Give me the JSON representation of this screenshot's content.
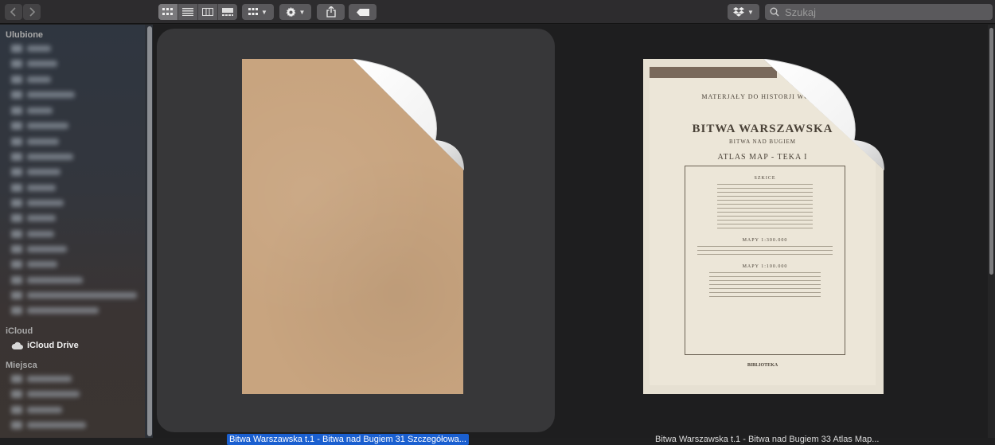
{
  "toolbar": {
    "back_icon": "chevron-left-icon",
    "forward_icon": "chevron-right-icon",
    "view_modes": [
      "icon-view",
      "list-view",
      "column-view",
      "gallery-view"
    ],
    "active_view": "icon-view",
    "search": {
      "placeholder": "Szukaj",
      "value": ""
    }
  },
  "sidebar": {
    "favorites_heading": "Ulubione",
    "icloud_heading": "iCloud",
    "icloud_drive_label": "iCloud Drive",
    "places_heading": "Miejsca"
  },
  "files": [
    {
      "name": "Bitwa Warszawska t.1 - Bitwa nad Bugiem 31 Szczegółowa...",
      "selected": true,
      "kind": "blank-cover"
    },
    {
      "name": "Bitwa Warszawska t.1 - Bitwa nad Bugiem 33 Atlas Map...",
      "selected": false,
      "kind": "atlas-cover"
    }
  ],
  "cover": {
    "series": "MATERJAŁY DO HISTORJI WOJNY",
    "title": "BITWA WARSZAWSKA",
    "subtitle": "BITWA NAD BUGIEM",
    "atlas": "ATLAS MAP - TEKA I",
    "box_heading": "SZKICE",
    "box_heading_2": "MAPY 1:300.000",
    "box_heading_3": "MAPY 1:100.000",
    "library": "BIBLIOTEKA"
  },
  "colors": {
    "selection": "#1a5fd0",
    "tile": "#373739",
    "background": "#1e1e1f"
  }
}
